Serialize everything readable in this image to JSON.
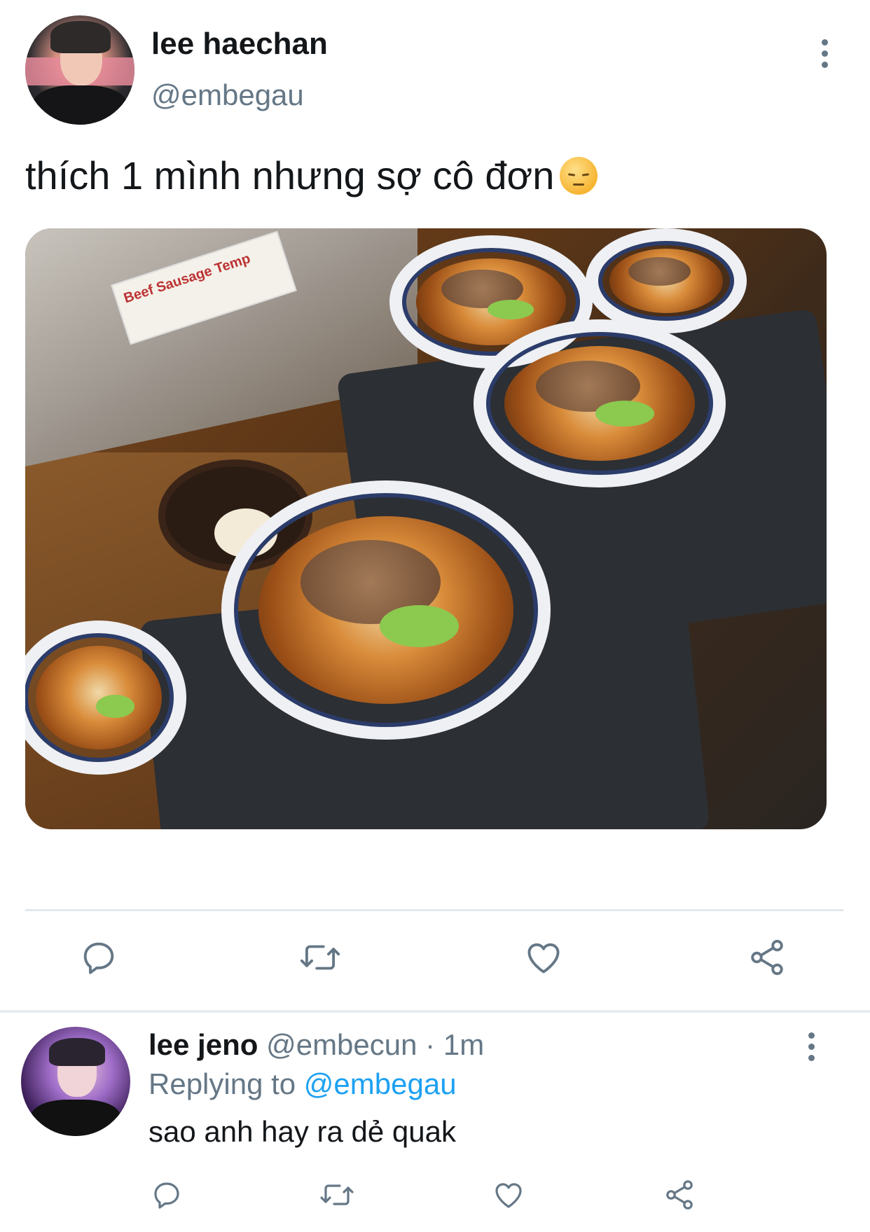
{
  "tweet": {
    "author_name": "lee haechan",
    "author_handle": "@embegau",
    "text": "thích 1 mình nhưng sợ cô đơn",
    "emoji": "pensive-face",
    "photo": {
      "sign_text": "Beef Sausage Temp"
    }
  },
  "reply": {
    "author_name": "lee jeno",
    "author_handle": "@embecun",
    "separator": "·",
    "time": "1m",
    "replying_label": "Replying to",
    "replying_to": "@embegau",
    "text": "sao anh hay ra dẻ quak"
  },
  "icons": {
    "reply": "reply-icon",
    "retweet": "retweet-icon",
    "like": "heart-icon",
    "share": "share-icon",
    "more": "more-vertical-icon"
  },
  "colors": {
    "text": "#14171a",
    "secondary": "#657786",
    "link": "#1da1f2",
    "divider": "#e1e8ed"
  }
}
